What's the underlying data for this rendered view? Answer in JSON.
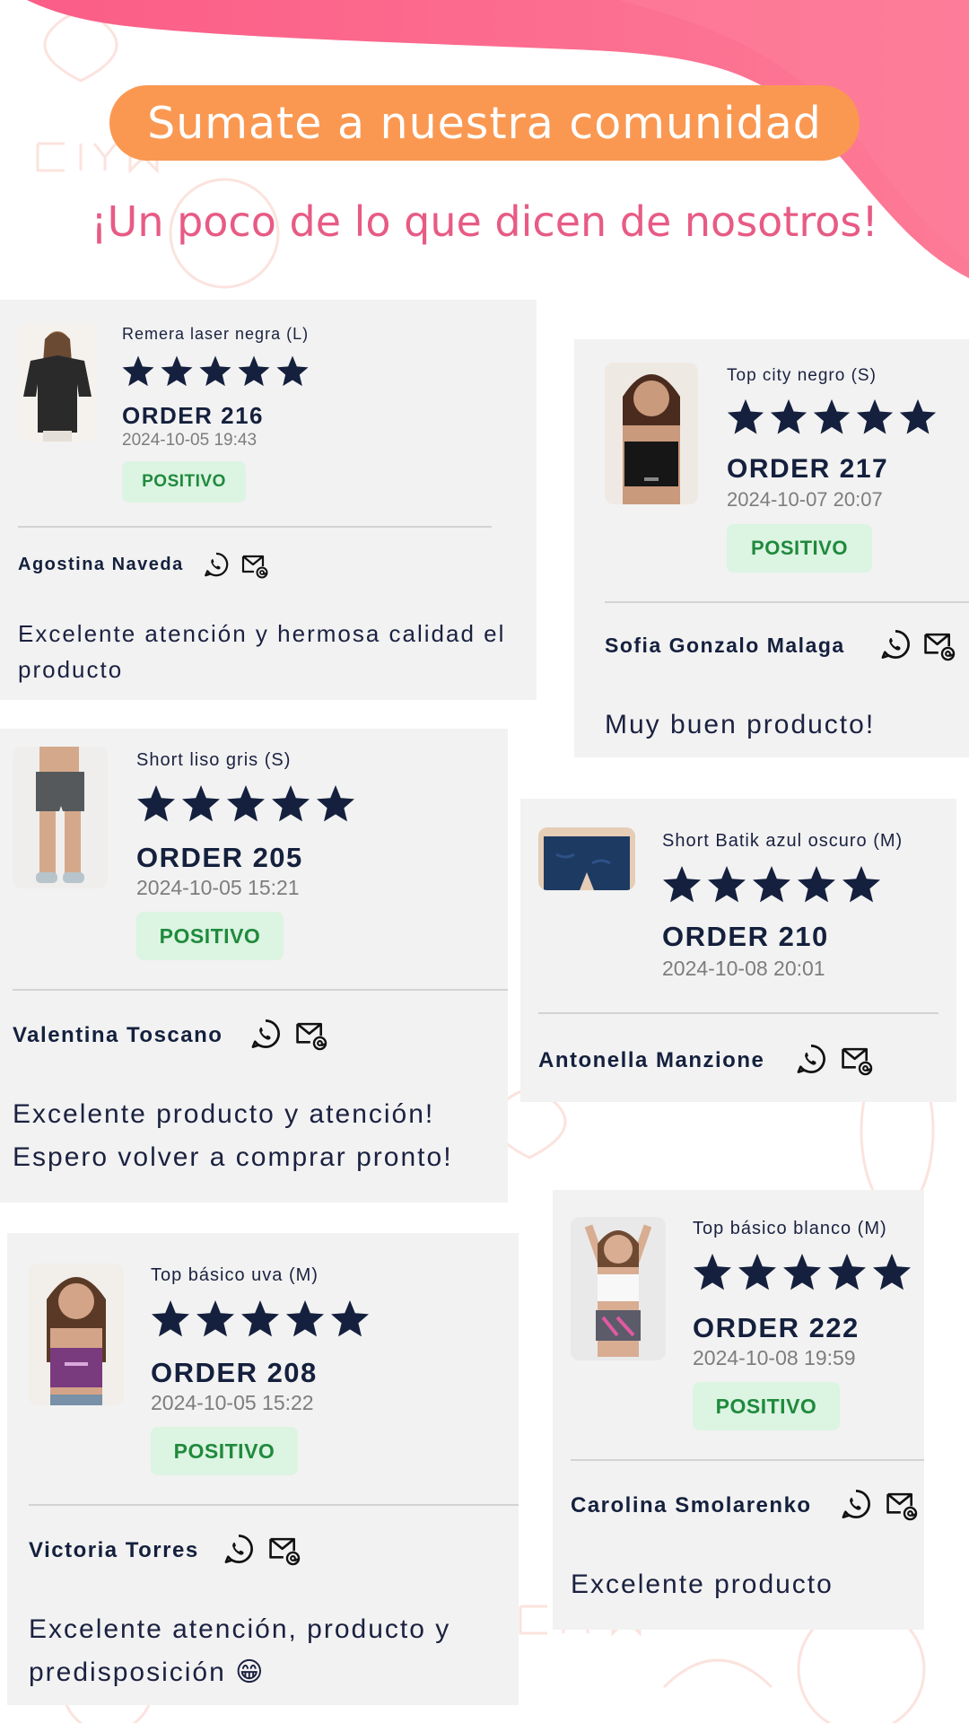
{
  "header": {
    "title": "Sumate a nuestra comunidad",
    "subtitle": "¡Un poco de lo que dicen de nosotros!"
  },
  "colors": {
    "accent_orange": "#fa9852",
    "accent_pink": "#e75b85",
    "wave_pink": "#f65a87",
    "star_navy": "#14203d",
    "badge_bg": "#dcf4e2",
    "badge_text": "#1f8a3c"
  },
  "reviews": [
    {
      "product": "Remera laser negra (L)",
      "rating": 5,
      "order": "ORDER 216",
      "date": "2024-10-05 19:43",
      "badge": "POSITIVO",
      "customer": "Agostina Naveda",
      "comment": "Excelente atención y hermosa calidad el producto",
      "thumb": "tshirt-black"
    },
    {
      "product": "Top city negro (S)",
      "rating": 5,
      "order": "ORDER 217",
      "date": "2024-10-07 20:07",
      "badge": "POSITIVO",
      "customer": "Sofia Gonzalo Malaga",
      "comment": "Muy buen producto!",
      "thumb": "top-black"
    },
    {
      "product": "Short liso gris (S)",
      "rating": 5,
      "order": "ORDER 205",
      "date": "2024-10-05 15:21",
      "badge": "POSITIVO",
      "customer": "Valentina Toscano",
      "comment": "Excelente producto y atención! Espero volver a comprar pronto!",
      "thumb": "short-grey"
    },
    {
      "product": "Short Batik azul oscuro (M)",
      "rating": 5,
      "order": "ORDER 210",
      "date": "2024-10-08 20:01",
      "badge": "",
      "customer": "Antonella Manzione",
      "comment": "",
      "thumb": "short-navy"
    },
    {
      "product": "Top básico uva (M)",
      "rating": 5,
      "order": "ORDER 208",
      "date": "2024-10-05 15:22",
      "badge": "POSITIVO",
      "customer": "Victoria Torres",
      "comment": "Excelente atención, producto y predisposición 😁",
      "thumb": "top-purple"
    },
    {
      "product": "Top básico blanco (M)",
      "rating": 5,
      "order": "ORDER 222",
      "date": "2024-10-08 19:59",
      "badge": "POSITIVO",
      "customer": "Carolina Smolarenko",
      "comment": "Excelente producto",
      "thumb": "top-white"
    }
  ],
  "icons": [
    "whatsapp-icon",
    "email-icon",
    "star-icon"
  ]
}
